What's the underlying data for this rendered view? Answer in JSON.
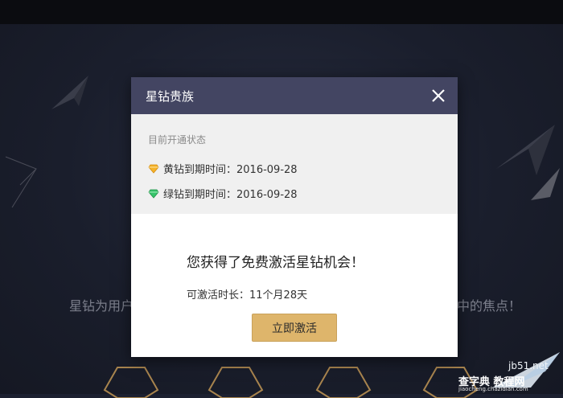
{
  "background": {
    "slogan_left": "星钻为用户",
    "slogan_right": "中的焦点！"
  },
  "dialog": {
    "title": "星钻贵族",
    "close_icon": "close-icon",
    "status": {
      "label": "目前开通状态",
      "yellow": {
        "icon": "yellow-diamond-icon",
        "text": "黄钻到期时间：2016-09-28",
        "color": "#f0a51a"
      },
      "green": {
        "icon": "green-diamond-icon",
        "text": "绿钻到期时间：2016-09-28",
        "color": "#2bb35a"
      }
    },
    "headline": "您获得了免费激活星钻机会！",
    "duration": "可激活时长：11个月28天",
    "activate_label": "立即激活"
  },
  "watermark": {
    "line1": "jb51.net",
    "line2": "查字典 教程网",
    "line3": "jiaocheng.chazidian.com"
  },
  "colors": {
    "header": "#434562",
    "button": "#deb56b",
    "status_bg": "#f0f0f0"
  }
}
